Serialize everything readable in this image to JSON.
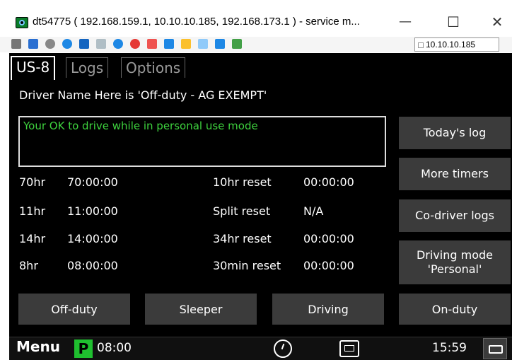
{
  "window": {
    "title": "dt54775 ( 192.168.159.1, 10.10.10.185, 192.168.173.1 ) - service m...",
    "minimize": "—",
    "maximize": "☐",
    "close": "✕",
    "address": "10.10.10.185"
  },
  "toolbar_icons": [
    "gear-icon",
    "monitor-icon",
    "settings-icon",
    "refresh-icon",
    "windows-icon",
    "window-icon",
    "info-icon",
    "stop-icon",
    "document-icon",
    "display-icon",
    "folder-icon",
    "network-icon",
    "share-icon",
    "chat-icon"
  ],
  "tabs": [
    {
      "label": "US-8"
    },
    {
      "label": "Logs"
    },
    {
      "label": "Options"
    }
  ],
  "driver_line": "Driver Name Here is 'Off-duty - AG EXEMPT'",
  "message": "Your OK to drive while in personal use mode",
  "timers_left": [
    {
      "label": "70hr",
      "value": "70:00:00"
    },
    {
      "label": "11hr",
      "value": "11:00:00"
    },
    {
      "label": "14hr",
      "value": "14:00:00"
    },
    {
      "label": "8hr",
      "value": "08:00:00"
    }
  ],
  "timers_right": [
    {
      "label": "10hr reset",
      "value": "00:00:00"
    },
    {
      "label": "Split reset",
      "value": "N/A"
    },
    {
      "label": "34hr reset",
      "value": "00:00:00"
    },
    {
      "label": "30min reset",
      "value": "00:00:00"
    }
  ],
  "side_buttons": [
    {
      "label": "Today's log"
    },
    {
      "label": "More timers"
    },
    {
      "label": "Co-driver logs"
    },
    {
      "label": "Driving mode\n'Personal'"
    }
  ],
  "bottom_buttons": [
    {
      "label": "Off-duty"
    },
    {
      "label": "Sleeper"
    },
    {
      "label": "Driving"
    },
    {
      "label": "On-duty"
    }
  ],
  "statusbar": {
    "menu": "Menu",
    "badge": "P",
    "badge_time": "08:00",
    "clock": "15:59"
  },
  "colors": {
    "background": "#000000",
    "message_green": "#3ed33e",
    "button_gray": "#3b3b3b",
    "badge_green": "#1fbf2f"
  }
}
